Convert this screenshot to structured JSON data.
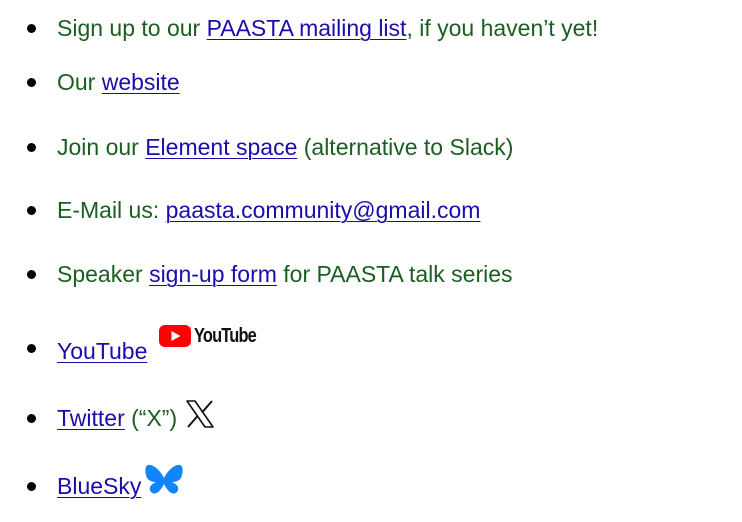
{
  "items": [
    {
      "pre": "Sign up to our ",
      "link": "PAASTA mailing list",
      "post": ", if you haven’t yet!"
    },
    {
      "pre": "Our ",
      "link": "website",
      "post": ""
    },
    {
      "pre": "Join our ",
      "link": "Element space",
      "post": " (alternative to Slack)"
    },
    {
      "pre": "E-Mail us: ",
      "link": "paasta.community@gmail.com",
      "post": ""
    },
    {
      "pre": "Speaker ",
      "link": "sign-up form",
      "post": " for PAASTA talk series"
    },
    {
      "pre": "",
      "link": "YouTube",
      "post": "",
      "logo_text": "YouTube",
      "icon": "youtube-logo-icon"
    },
    {
      "pre": "",
      "link": "Twitter",
      "post": " (“X”)",
      "icon": "x-logo-icon"
    },
    {
      "pre": "",
      "link": "BlueSky",
      "post": "",
      "icon": "bluesky-butterfly-icon"
    }
  ],
  "colors": {
    "text": "#1b5e20",
    "link": "#1a0dab",
    "youtube_red": "#ff0000",
    "bluesky_blue": "#1185fe"
  }
}
